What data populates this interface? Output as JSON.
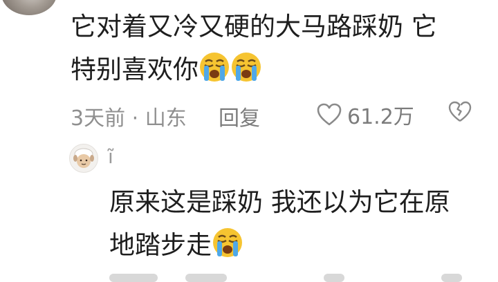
{
  "comment": {
    "text_line1": "它对着又冷又硬的大马路踩奶 它",
    "text_line2": "特别喜欢你",
    "emoji_name": "loudly-crying-face",
    "time_location": "3天前 · 山东",
    "reply_label": "回复",
    "like_count": "61.2万"
  },
  "reply": {
    "username": "ĩ",
    "text_line1": "原来这是踩奶 我还以为它在原",
    "text_line2": "地踏步走",
    "emoji_name": "loudly-crying-face"
  },
  "colors": {
    "text": "#1e1e1e",
    "meta": "#8f8f8f",
    "emoji_face": "#f6c431",
    "emoji_tears": "#4fa8e8"
  }
}
